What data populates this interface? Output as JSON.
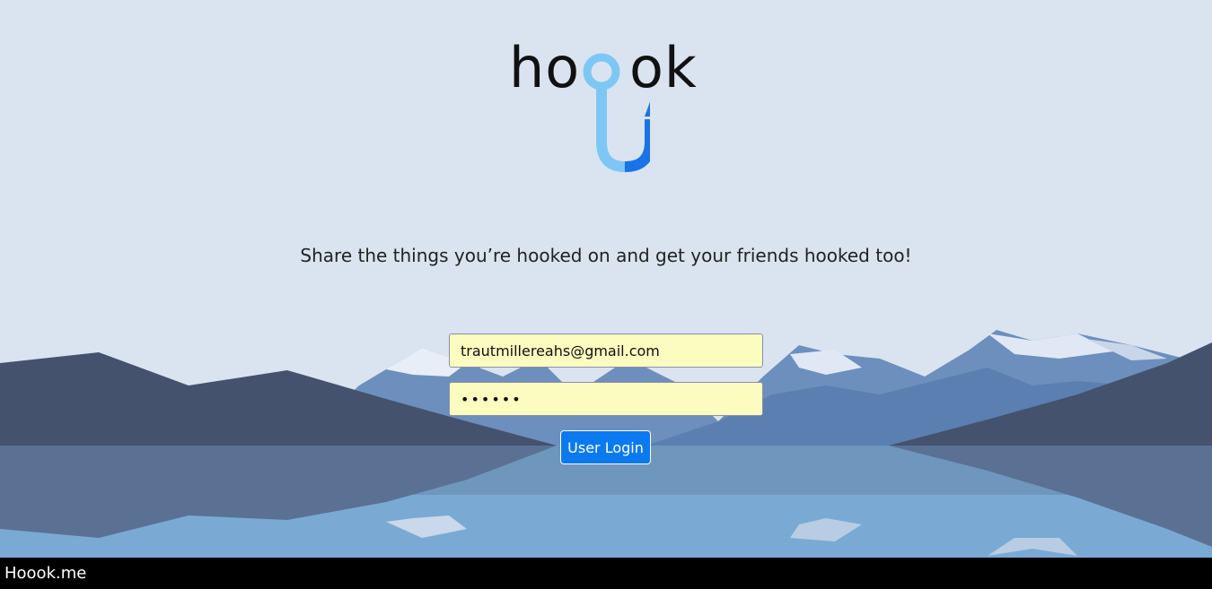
{
  "brand": {
    "logo_left": "ho",
    "logo_right": "ok",
    "logo_icon": "fish-hook-icon"
  },
  "tagline": "Share the things you’re hooked on and get your friends hooked too!",
  "login_form": {
    "email_value": "trautmillereahs@gmail.com",
    "password_value": "••••••",
    "submit_label": "User Login"
  },
  "footer": {
    "site_name": "Hoook.me"
  },
  "colors": {
    "sky": "#d9e4f0",
    "button": "#0b7af0",
    "autofill": "#fafcc0",
    "hook_light": "#7ec7f5",
    "hook_dark": "#1a73e8"
  }
}
